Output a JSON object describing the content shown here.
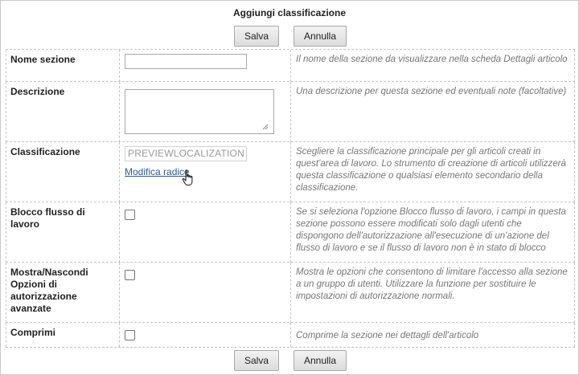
{
  "dialog": {
    "title": "Aggiungi classificazione",
    "save_label": "Salva",
    "cancel_label": "Annulla"
  },
  "rows": [
    {
      "label": "Nome sezione",
      "help": "Il nome della sezione da visualizzare nella scheda Dettagli articolo",
      "value": ""
    },
    {
      "label": "Descrizione",
      "help": "Una descrizione per questa sezione ed eventuali note (facoltative)",
      "value": ""
    },
    {
      "label": "Classificazione",
      "help": "Scegliere la classificazione principale per gli articoli creati in quest'area di lavoro. Lo strumento di creazione di articoli utilizzerà questa classificazione o qualsiasi elemento secondario della classificazione.",
      "value": "PREVIEWLOCALIZATION",
      "link": "Modifica radice"
    },
    {
      "label": "Blocco flusso di lavoro",
      "help": "Se si seleziona l'opzione Blocco flusso di lavoro, i campi in questa sezione possono essere modificati solo dagli utenti che dispongono dell'autorizzazione all'esecuzione di un'azione del flusso di lavoro e se il flusso di lavoro non è in stato di blocco",
      "checked": false
    },
    {
      "label": "Mostra/Nascondi Opzioni di autorizzazione avanzate",
      "help": "Mostra le opzioni che consentono di limitare l'accesso alla sezione a un gruppo di utenti. Utilizzare la funzione per sostituire le impostazioni di autorizzazione normali.",
      "checked": false
    },
    {
      "label": "Comprimi",
      "help": "Comprime la sezione nei dettagli dell'articolo",
      "checked": false
    }
  ]
}
